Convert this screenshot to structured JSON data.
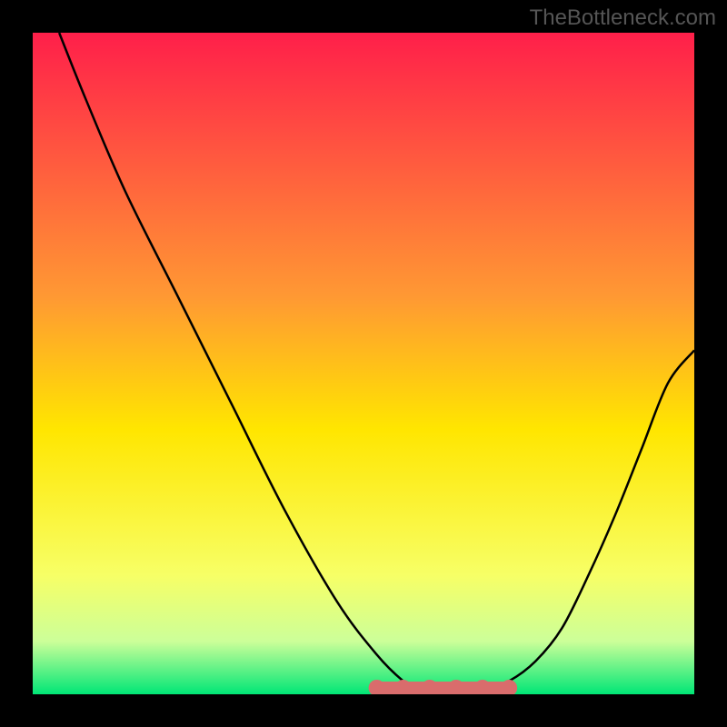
{
  "watermark": "TheBottleneck.com",
  "chart_data": {
    "type": "line",
    "title": "",
    "xlabel": "",
    "ylabel": "",
    "xlim": [
      0,
      100
    ],
    "ylim": [
      0,
      100
    ],
    "background_gradient": {
      "stops": [
        {
          "offset": 0,
          "color": "#ff1f4a"
        },
        {
          "offset": 40,
          "color": "#ff9933"
        },
        {
          "offset": 60,
          "color": "#ffe600"
        },
        {
          "offset": 82,
          "color": "#f7ff66"
        },
        {
          "offset": 92,
          "color": "#ccff99"
        },
        {
          "offset": 100,
          "color": "#00e676"
        }
      ]
    },
    "curves": [
      {
        "name": "left-curve",
        "x": [
          4,
          8,
          14,
          22,
          30,
          38,
          46,
          52,
          56,
          58,
          60,
          62,
          64
        ],
        "y": [
          100,
          90,
          76,
          60,
          44,
          28,
          14,
          6,
          2,
          1,
          0.5,
          0.2,
          0
        ]
      },
      {
        "name": "right-curve",
        "x": [
          64,
          68,
          72,
          76,
          80,
          84,
          88,
          92,
          96,
          100
        ],
        "y": [
          0,
          0.5,
          2,
          5,
          10,
          18,
          27,
          37,
          47,
          52
        ]
      }
    ],
    "bottom_marker_band": {
      "y": 0,
      "x_start": 52,
      "x_end": 72,
      "color": "#d96c6c",
      "markers_x": [
        52,
        56,
        60,
        64,
        68,
        72
      ]
    }
  }
}
